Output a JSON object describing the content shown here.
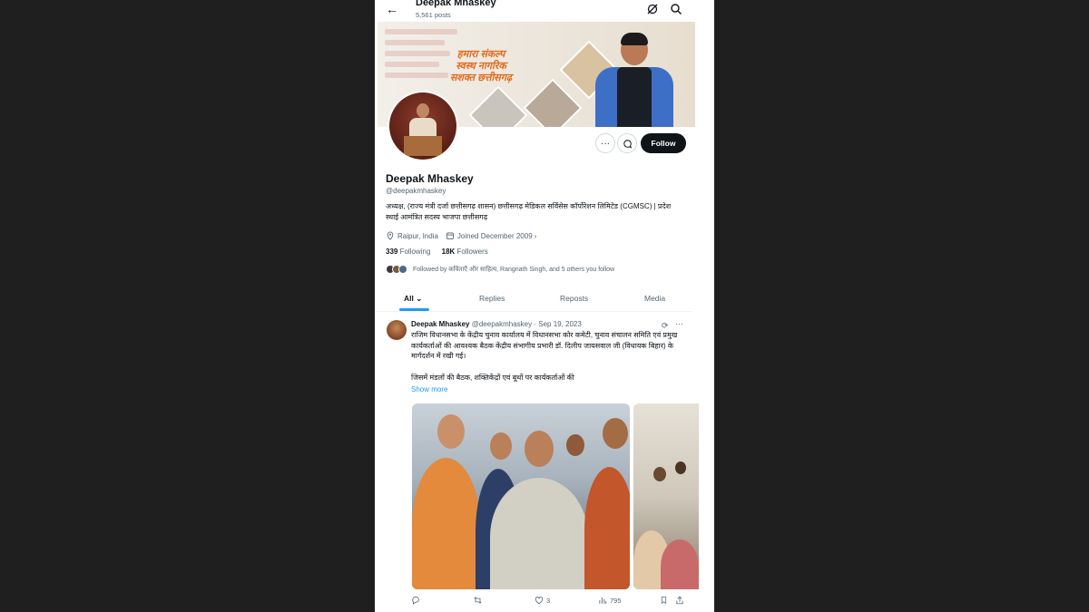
{
  "header": {
    "back_icon": "arrow-left-icon",
    "title": "Deepak Mhaskey",
    "posts": "5,561 posts"
  },
  "banner": {
    "slogan_line1": "हमारा संकल्प",
    "slogan_line2": "स्वस्थ नागरिक",
    "slogan_line3": "सशक्त छत्तीसगढ़",
    "accent": "#e46a1a"
  },
  "profile": {
    "name": "Deepak Mhaskey",
    "handle": "@deepakmhaskey",
    "bio": "अध्यक्ष, (राज्य मंत्री दर्जा छत्तीसगढ़ शासन) छत्तीसगढ़ मेडिकल सर्विसेस कॉर्पोरेशन लिमिटेड (CGMSC) | प्रदेश स्थाई आमंत्रित सदस्य भाजपा छत्तीसगढ़",
    "location": "Raipur, India",
    "joined": "Joined December 2009",
    "following_count": "339",
    "following_label": "Following",
    "followers_count": "18K",
    "followers_label": "Followers",
    "followed_by": "Followed by कविताएँ और साहित्य, Rangnath Singh, and 5 others you follow",
    "follow_label": "Follow",
    "more_label": "···"
  },
  "tabs": [
    {
      "label": "All"
    },
    {
      "label": "Replies"
    },
    {
      "label": "Reposts"
    },
    {
      "label": "Media"
    }
  ],
  "post": {
    "author": "Deepak Mhaskey",
    "handle": "@deepakmhaskey",
    "date": "· Sep 19, 2023",
    "text1": "राजिम विधानसभा के केंद्रीय चुनाव कार्यालय में विधानसभा कोर कमेटी, चुनाव संचालन समिति एवं प्रमुख कार्यकर्ताओं की आवश्यक बैठक केंद्रीय संभागीय प्रभारी डॉ. दिलीप जायसवाल जी (विधायक बिहार) के मार्गदर्शन में रखी गई।",
    "text2": "जिसमें मंडलों की बैठक, शक्तिकेंद्रों एवं बूथों पर कार्यकर्ताओं की",
    "show_more": "Show more",
    "likes": "3",
    "views": "795"
  },
  "colors": {
    "accent_blue": "#1d9bf0",
    "text": "#0f1419",
    "muted": "#536471",
    "follow_bg": "#0f1419"
  }
}
